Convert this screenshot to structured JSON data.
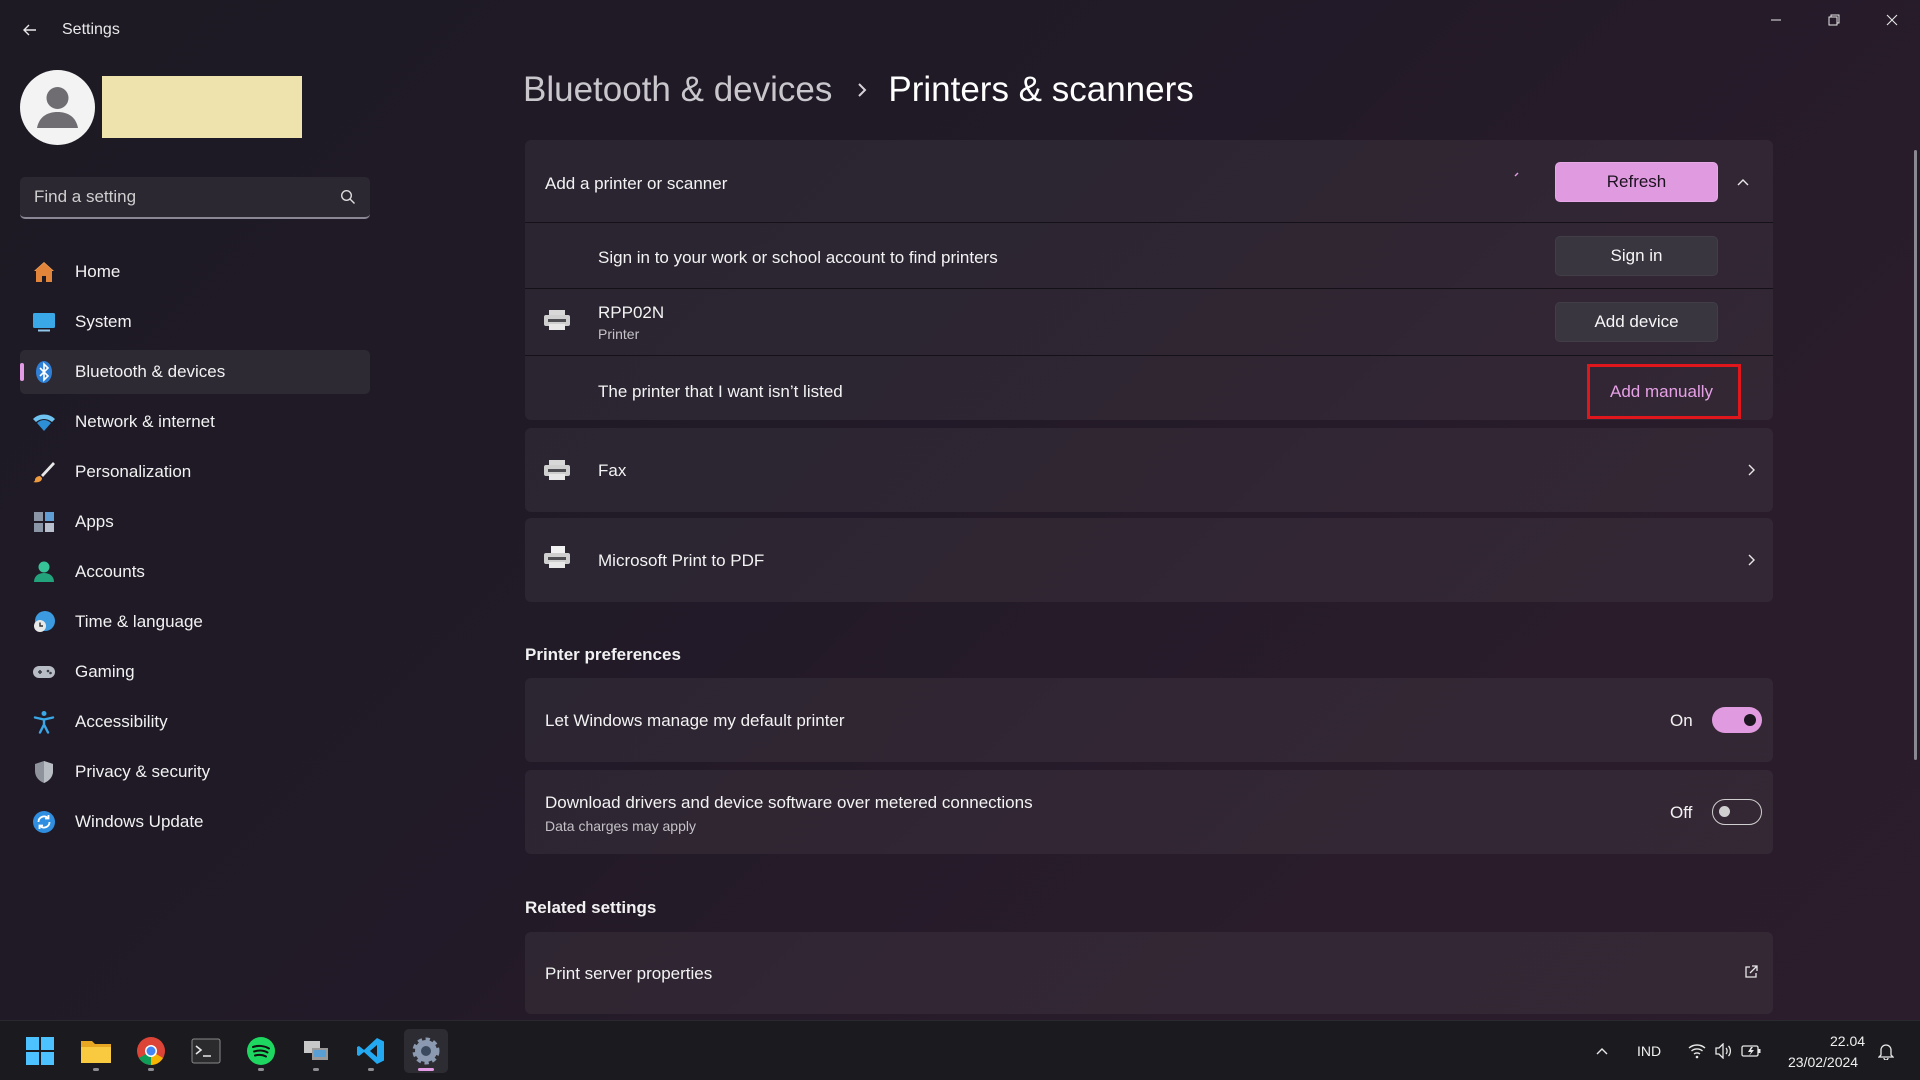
{
  "window": {
    "title": "Settings"
  },
  "search": {
    "placeholder": "Find a setting"
  },
  "sidebar": {
    "items": [
      {
        "label": "Home"
      },
      {
        "label": "System"
      },
      {
        "label": "Bluetooth & devices"
      },
      {
        "label": "Network & internet"
      },
      {
        "label": "Personalization"
      },
      {
        "label": "Apps"
      },
      {
        "label": "Accounts"
      },
      {
        "label": "Time & language"
      },
      {
        "label": "Gaming"
      },
      {
        "label": "Accessibility"
      },
      {
        "label": "Privacy & security"
      },
      {
        "label": "Windows Update"
      }
    ],
    "active_item": "Bluetooth & devices"
  },
  "breadcrumb": {
    "parent": "Bluetooth & devices",
    "current": "Printers & scanners"
  },
  "add_printer": {
    "title": "Add a printer or scanner",
    "refresh_label": "Refresh",
    "signin_text": "Sign in to your work or school account to find printers",
    "signin_button": "Sign in",
    "device_name": "RPP02N",
    "device_type": "Printer",
    "add_device_button": "Add device",
    "not_listed_text": "The printer that I want isn’t listed",
    "add_manually_link": "Add manually"
  },
  "printers": [
    {
      "name": "Fax"
    },
    {
      "name": "Microsoft Print to PDF"
    }
  ],
  "preferences": {
    "heading": "Printer preferences",
    "default_printer": {
      "label": "Let Windows manage my default printer",
      "state": "On",
      "enabled": true
    },
    "metered": {
      "label": "Download drivers and device software over metered connections",
      "sub": "Data charges may apply",
      "state": "Off",
      "enabled": false
    }
  },
  "related": {
    "heading": "Related settings",
    "print_server": "Print server properties"
  },
  "taskbar": {
    "apps": [
      "start-icon",
      "file-explorer-icon",
      "chrome-icon",
      "terminal-icon",
      "spotify-icon",
      "remote-desktop-icon",
      "vscode-icon",
      "settings-icon"
    ],
    "language": "IND",
    "time": "22.04",
    "date": "23/02/2024"
  },
  "colors": {
    "accent": "#e09be0",
    "highlight": "#e0161d"
  }
}
